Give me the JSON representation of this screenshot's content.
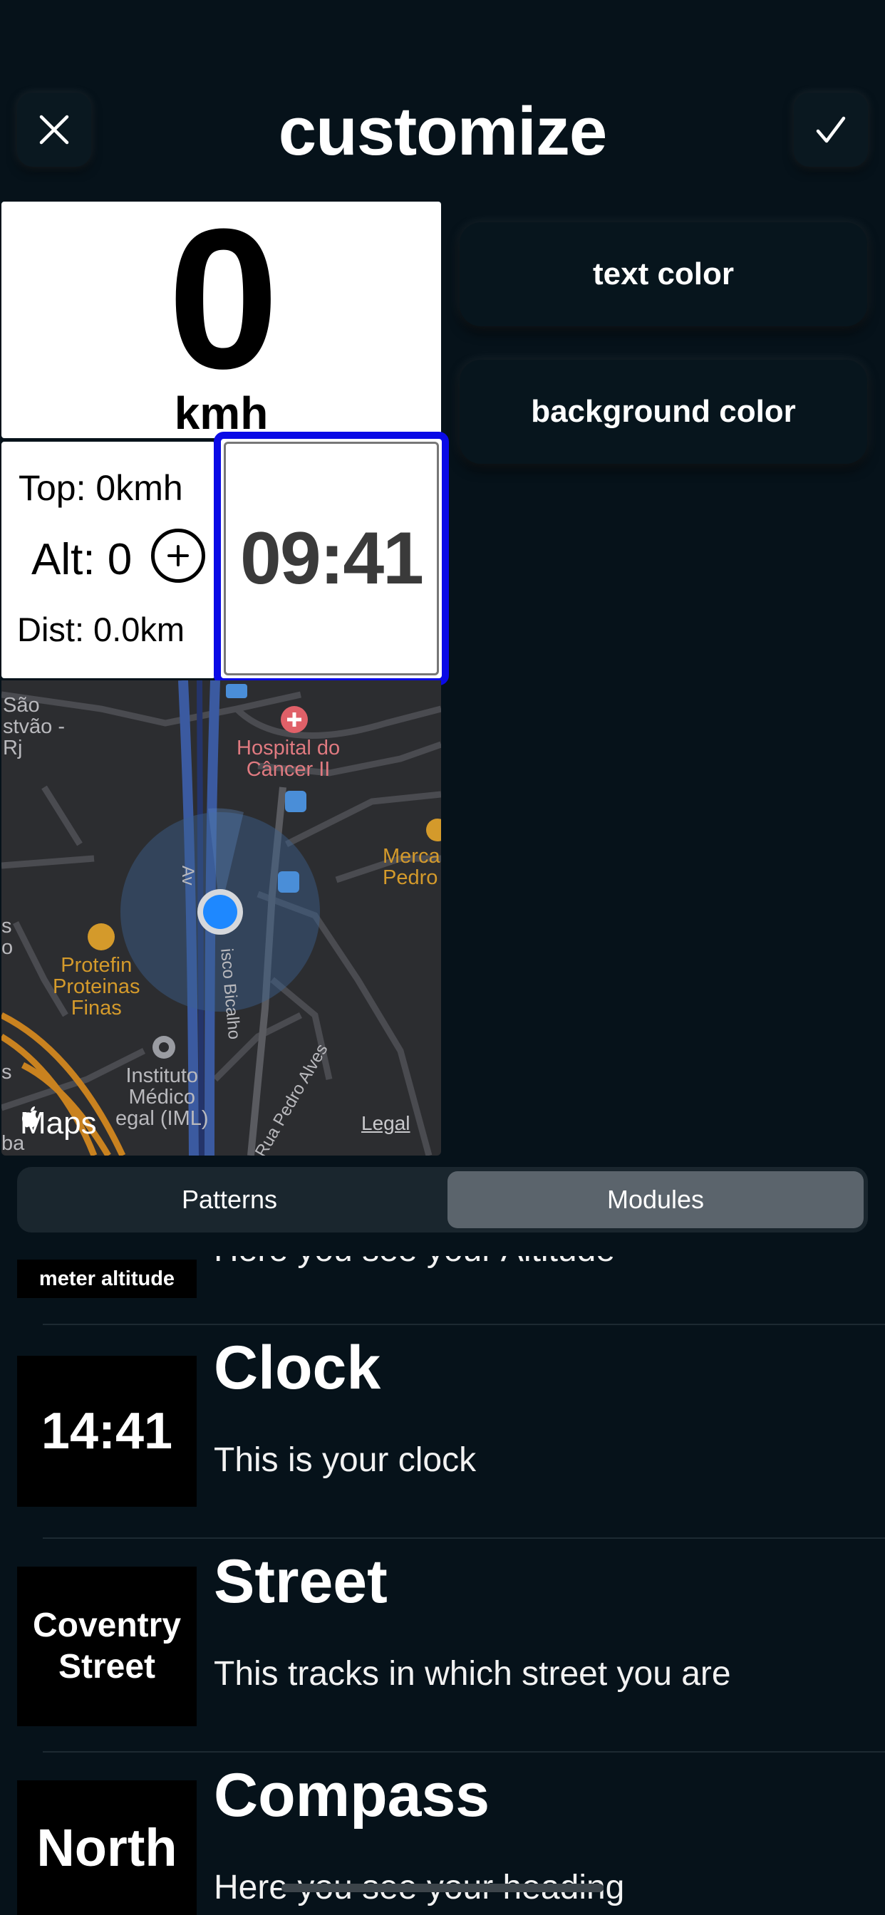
{
  "header": {
    "title": "customize",
    "close_icon": "close-icon",
    "confirm_icon": "checkmark-icon"
  },
  "actions": {
    "text_color_label": "text color",
    "background_color_label": "background color"
  },
  "preview": {
    "speed_value": "0",
    "speed_unit": "kmh",
    "top_speed": "Top: 0kmh",
    "altitude": "Alt: 0",
    "distance": "Dist: 0.0km",
    "clock_time": "09:41",
    "selected_outline_color": "#0a0ae6",
    "map": {
      "labels": {
        "sao_cristovao": "São\nstvão -\nRj",
        "hospital": "Hospital do\nCâncer II",
        "mercado": "Merca\nPedro",
        "protefin": "Protefin\nProteinas\nFinas",
        "instituto": "Instituto\nMédico\negal (IML)",
        "street_av": "Av",
        "street_bicalho": "isco Bicalho",
        "street_pedro_alves": "Rua Pedro Alves",
        "left_edge": "s\no",
        "ba": "ba",
        "s": "s"
      },
      "brand": "Maps",
      "legal": "Legal"
    }
  },
  "segmented": {
    "items": [
      "Patterns",
      "Modules"
    ],
    "selected": "Modules"
  },
  "modules": {
    "partial": {
      "thumb_text": "meter altitude",
      "desc": "Here you see your Altitude"
    },
    "items": [
      {
        "thumb": "14:41",
        "title": "Clock",
        "desc": "This is your clock"
      },
      {
        "thumb": "Coventry\nStreet",
        "title": "Street",
        "desc": "This tracks in which street you are"
      },
      {
        "thumb": "North",
        "title": "Compass",
        "desc": "Here you see your heading"
      }
    ]
  },
  "colors": {
    "background": "#06121a",
    "accent_selected": "#0a0ae6",
    "map_user_dot": "#1e88ff"
  }
}
